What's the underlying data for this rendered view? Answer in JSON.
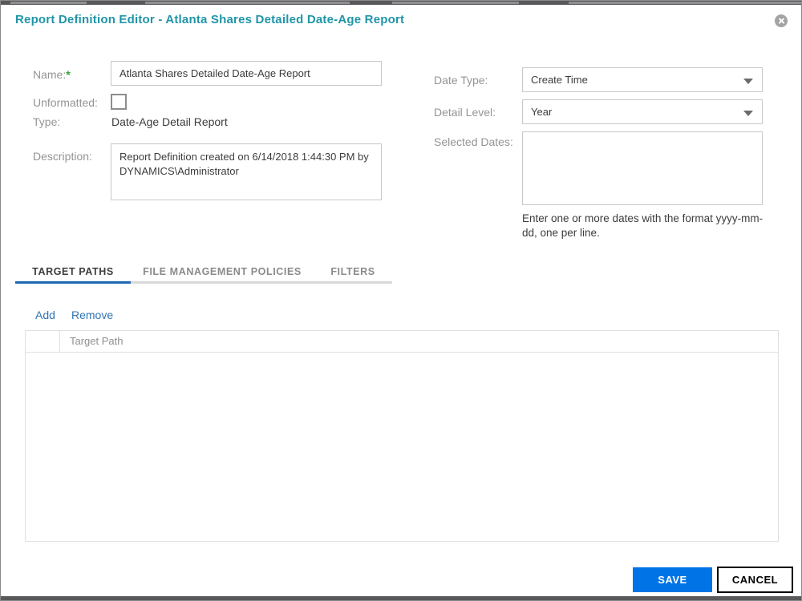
{
  "dialog": {
    "title": "Report Definition Editor - Atlanta Shares Detailed Date-Age Report",
    "close_icon": "circle-x-icon"
  },
  "form": {
    "name": {
      "label": "Name:",
      "required_marker": "*",
      "value": "Atlanta Shares Detailed Date-Age Report"
    },
    "unformatted": {
      "label": "Unformatted:",
      "checked": false
    },
    "type": {
      "label": "Type:",
      "value": "Date-Age Detail Report"
    },
    "description": {
      "label": "Description:",
      "value": "Report Definition created on 6/14/2018 1:44:30 PM by DYNAMICS\\Administrator"
    },
    "date_type": {
      "label": "Date Type:",
      "value": "Create Time",
      "icon": "caret-down-icon"
    },
    "detail_level": {
      "label": "Detail Level:",
      "value": "Year",
      "icon": "caret-down-icon"
    },
    "selected_dates": {
      "label": "Selected Dates:",
      "value": "",
      "hint": "Enter one or more dates with the format yyyy-mm-dd, one per line."
    }
  },
  "tabs": [
    {
      "label": "TARGET PATHS",
      "active": true
    },
    {
      "label": "FILE MANAGEMENT POLICIES",
      "active": false
    },
    {
      "label": "FILTERS",
      "active": false
    }
  ],
  "target_paths": {
    "add_label": "Add",
    "remove_label": "Remove",
    "table": {
      "columns": [
        "",
        "Target Path"
      ],
      "rows": []
    }
  },
  "footer": {
    "save_label": "SAVE",
    "cancel_label": "CANCEL"
  },
  "colors": {
    "title_teal": "#1f95a8",
    "save_blue": "#0073e7",
    "link_blue": "#3072b4",
    "tab_underline_blue": "#2068b4",
    "required_green": "#2da02d",
    "label_gray": "#949494"
  }
}
